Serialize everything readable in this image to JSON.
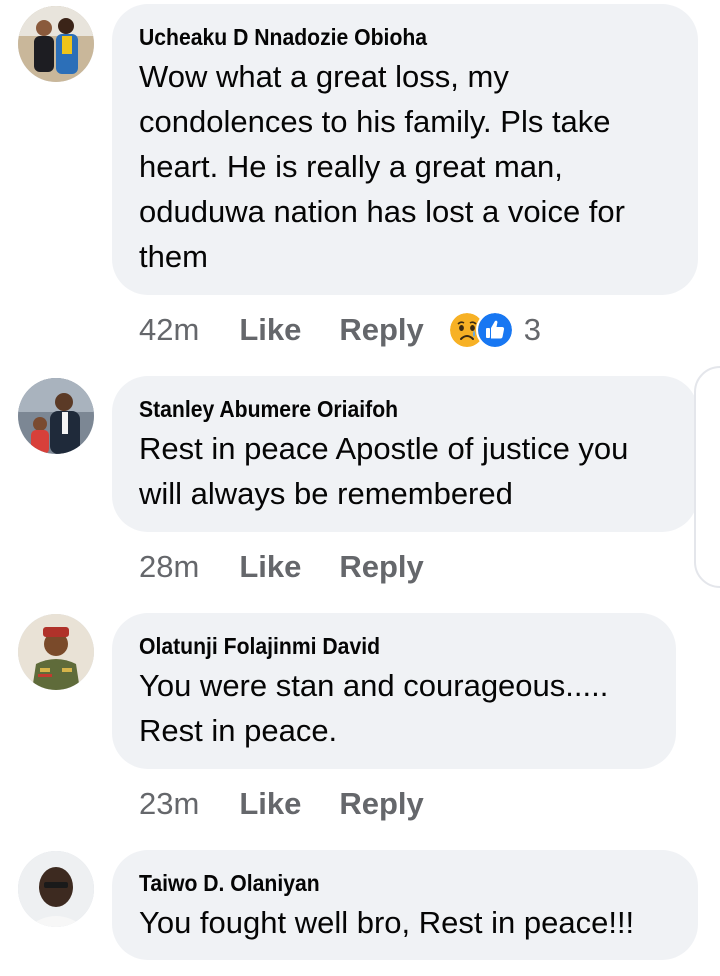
{
  "comments": [
    {
      "author": "Ucheaku D Nnadozie Obioha",
      "text": "Wow what a great loss, my condolences to his family. Pls take heart. He is really a great man, oduduwa nation has lost a voice for them",
      "time": "42m",
      "like_label": "Like",
      "reply_label": "Reply",
      "reactions": {
        "icons": [
          "sad-reaction-icon",
          "like-reaction-icon"
        ],
        "count": "3"
      }
    },
    {
      "author": "Stanley Abumere Oriaifoh",
      "text": "Rest in peace Apostle of justice you will always be remembered",
      "time": "28m",
      "like_label": "Like",
      "reply_label": "Reply"
    },
    {
      "author": "Olatunji Folajinmi David",
      "text": "You were stan and courageous..... Rest in peace.",
      "time": "23m",
      "like_label": "Like",
      "reply_label": "Reply"
    },
    {
      "author": "Taiwo D. Olaniyan",
      "text": "You fought well bro, Rest in peace!!!"
    }
  ],
  "colors": {
    "bubble": "#f0f2f5",
    "meta_text": "#65676b",
    "like_blue": "#1877f2",
    "sad_yellow": "#f7b125"
  }
}
